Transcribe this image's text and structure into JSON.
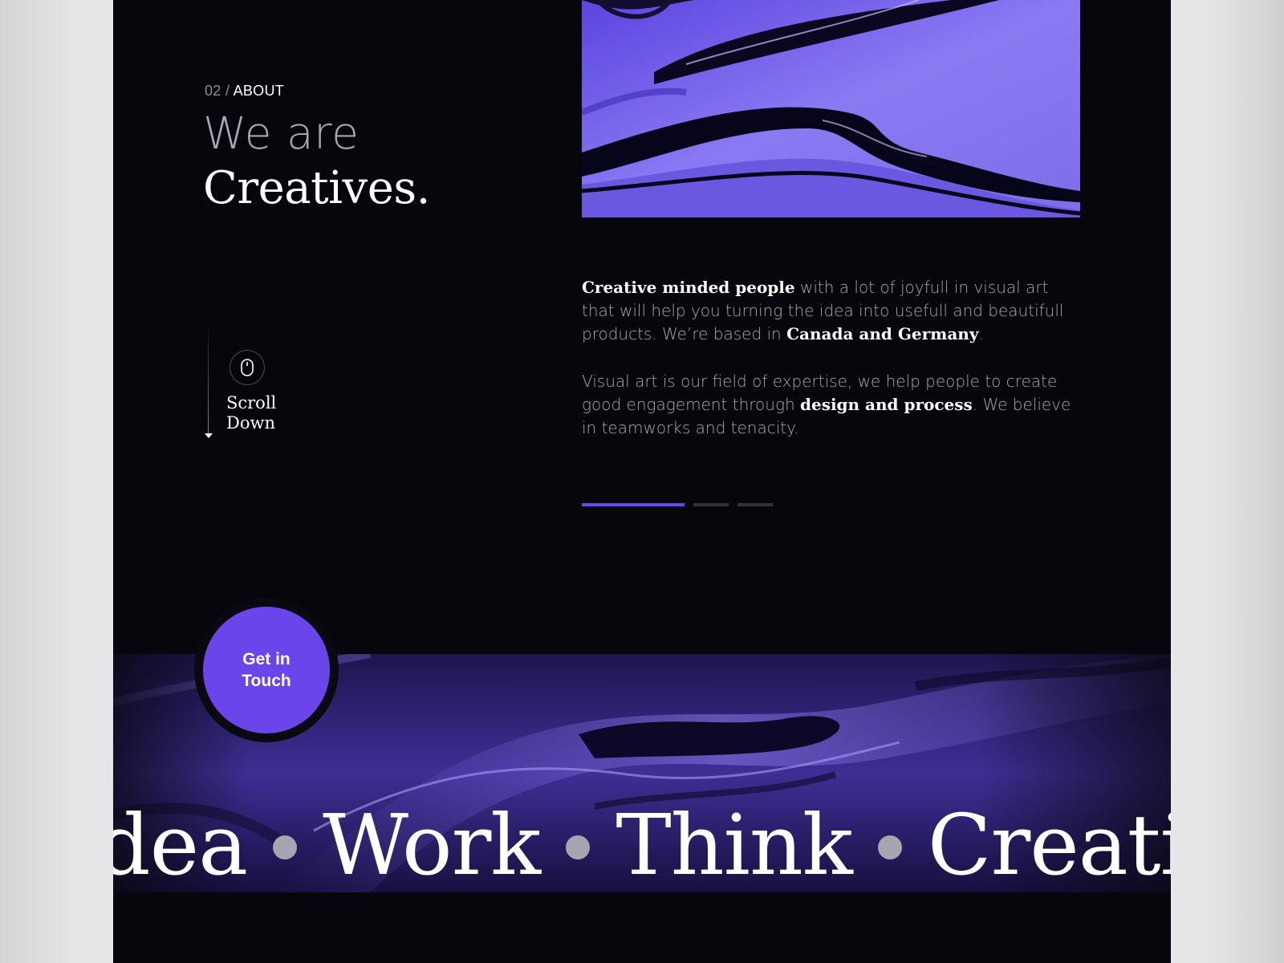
{
  "section": {
    "number": "02",
    "separator": "/",
    "label": "ABOUT"
  },
  "headline": {
    "line1": "We are",
    "line2": "Creatives."
  },
  "scroll_hint": {
    "line1": "Scroll",
    "line2": "Down",
    "icon": "mouse-icon"
  },
  "copy": {
    "p1": {
      "strong1": "Creative minded people",
      "text1": " with a lot of joyfull in visual art that will help you turning the idea into usefull and beautifull products. We’re based in ",
      "strong2": "Canada and Germany",
      "text2": "."
    },
    "p2": {
      "text1": "Visual art is our field of expertise, we help people to create good engagement through ",
      "strong1": "design and process",
      "text2": ". We believe in teamworks and tenacity."
    }
  },
  "slider": {
    "total": 3,
    "active_index": 0
  },
  "cta": {
    "line1": "Get in",
    "line2": "Touch"
  },
  "marquee": {
    "words": [
      "dea",
      "Work",
      "Think",
      "Creative"
    ]
  },
  "colors": {
    "background": "#08060d",
    "accent": "#6a45ea",
    "muted_text": "#a9a6b0",
    "inactive_bar": "#34313a"
  }
}
